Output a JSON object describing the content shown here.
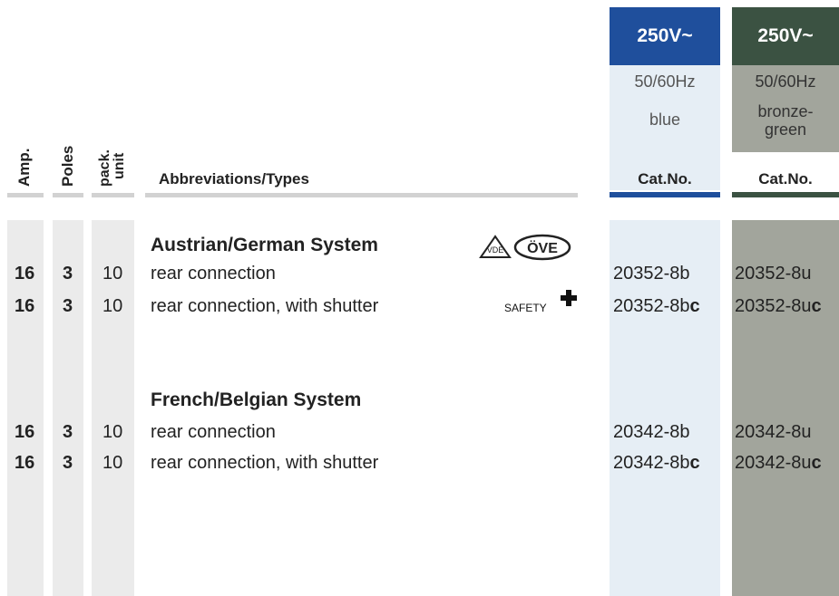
{
  "columns": {
    "amp": "Amp.",
    "poles": "Poles",
    "pack_line1": "pack.",
    "pack_line2": "unit",
    "abbrev": "Abbreviations/Types"
  },
  "variants": [
    {
      "voltage": "250V~",
      "freq": "50/60Hz",
      "color_line1": "blue",
      "color_line2": "",
      "cat": "Cat.No.",
      "accent": "#1f4f9c",
      "panel": "#e6eef5"
    },
    {
      "voltage": "250V~",
      "freq": "50/60Hz",
      "color_line1": "bronze-",
      "color_line2": "green",
      "cat": "Cat.No.",
      "accent": "#3b5242",
      "panel": "#a2a59c"
    }
  ],
  "sections": [
    {
      "title": "Austrian/German System",
      "rows": [
        {
          "amp": "16",
          "poles": "3",
          "pack": "10",
          "desc": "rear connection",
          "cat_blue": "20352-8b",
          "cat_blue_suffix": "",
          "cat_green": "20352-8u",
          "cat_green_suffix": ""
        },
        {
          "amp": "16",
          "poles": "3",
          "pack": "10",
          "desc": "rear connection, with shutter",
          "cat_blue": "20352-8b",
          "cat_blue_suffix": "c",
          "cat_green": "20352-8u",
          "cat_green_suffix": "c"
        }
      ],
      "marks": {
        "vde": "VDE",
        "ove": "ÖVE",
        "safety": "SAFETY"
      }
    },
    {
      "title": "French/Belgian System",
      "rows": [
        {
          "amp": "16",
          "poles": "3",
          "pack": "10",
          "desc": "rear connection",
          "cat_blue": "20342-8b",
          "cat_blue_suffix": "",
          "cat_green": "20342-8u",
          "cat_green_suffix": ""
        },
        {
          "amp": "16",
          "poles": "3",
          "pack": "10",
          "desc": "rear connection, with shutter",
          "cat_blue": "20342-8b",
          "cat_blue_suffix": "c",
          "cat_green": "20342-8u",
          "cat_green_suffix": "c"
        }
      ]
    }
  ]
}
